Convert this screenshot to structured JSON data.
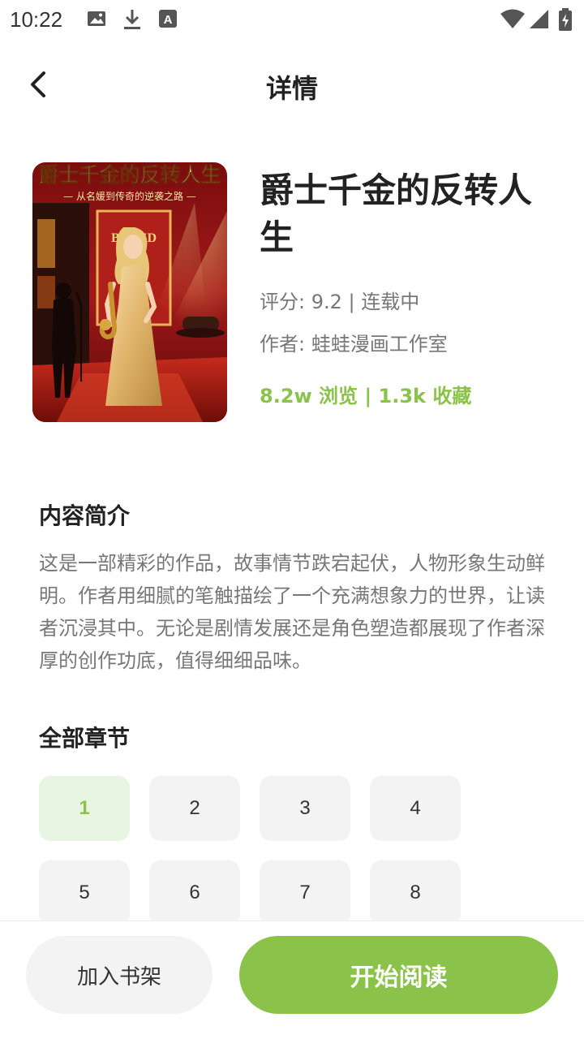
{
  "status_bar": {
    "time": "10:22",
    "left_icons": [
      "image-icon",
      "download-icon",
      "font-icon"
    ],
    "right_icons": [
      "wifi-icon",
      "signal-icon",
      "battery-icon"
    ]
  },
  "header": {
    "title": "详情",
    "back_icon": "chevron-left-icon"
  },
  "book": {
    "cover_title": "爵士千金的反转人生",
    "cover_subtitle": "— 从名媛到传奇的逆袭之路 —",
    "cover_sign": "BOZZD",
    "title": "爵士千金的反转人生",
    "rating": "评分: 9.2 | 连载中",
    "author": "作者: 蛙蛙漫画工作室",
    "stats": "8.2w 浏览 | 1.3k 收藏"
  },
  "intro": {
    "heading": "内容简介",
    "text": "这是一部精彩的作品，故事情节跌宕起伏，人物形象生动鲜明。作者用细腻的笔触描绘了一个充满想象力的世界，让读者沉浸其中。无论是剧情发展还是角色塑造都展现了作者深厚的创作功底，值得细细品味。"
  },
  "chapters": {
    "heading": "全部章节",
    "items": [
      "1",
      "2",
      "3",
      "4",
      "5",
      "6",
      "7",
      "8"
    ],
    "active": "1"
  },
  "actions": {
    "shelf_label": "加入书架",
    "read_label": "开始阅读"
  },
  "colors": {
    "accent": "#8bc34a",
    "accent_light": "#e8f5e3",
    "chip_bg": "#f3f3f3"
  }
}
